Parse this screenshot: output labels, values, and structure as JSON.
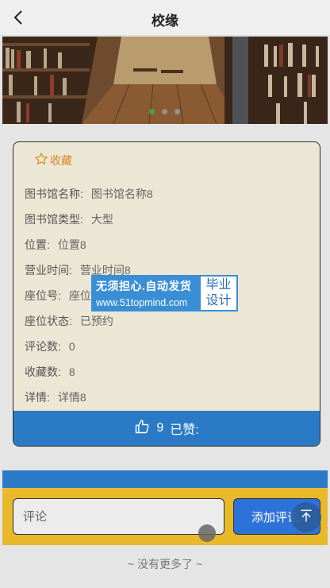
{
  "header": {
    "title": "校缘"
  },
  "banner": {
    "slides": 3,
    "active_slide": 0
  },
  "favorite": {
    "label": "收藏"
  },
  "details": [
    {
      "label": "图书馆名称:",
      "value": "图书馆名称8"
    },
    {
      "label": "图书馆类型:",
      "value": "大型"
    },
    {
      "label": "位置:",
      "value": "位置8"
    },
    {
      "label": "营业时间:",
      "value": "营业时间8"
    },
    {
      "label": "座位号:",
      "value": "座位号8"
    },
    {
      "label": "座位状态:",
      "value": "已预约"
    },
    {
      "label": "评论数:",
      "value": "0"
    },
    {
      "label": "收藏数:",
      "value": "8"
    },
    {
      "label": "详情:",
      "value": "详情8"
    }
  ],
  "like": {
    "count": "9",
    "label": "已赞:"
  },
  "comment": {
    "placeholder": "评论",
    "submit_label": "添加评论"
  },
  "footer": {
    "no_more": "~ 没有更多了 ~"
  },
  "watermark": {
    "line1": "无须担心.自动发货",
    "line2": "www.51topmind.com",
    "badge1": "毕业",
    "badge2": "设计"
  },
  "colors": {
    "accent_blue": "#2b7ac6",
    "favorite": "#d48a21",
    "comment_bg": "#e8b92a",
    "button_blue": "#2d72d9"
  }
}
